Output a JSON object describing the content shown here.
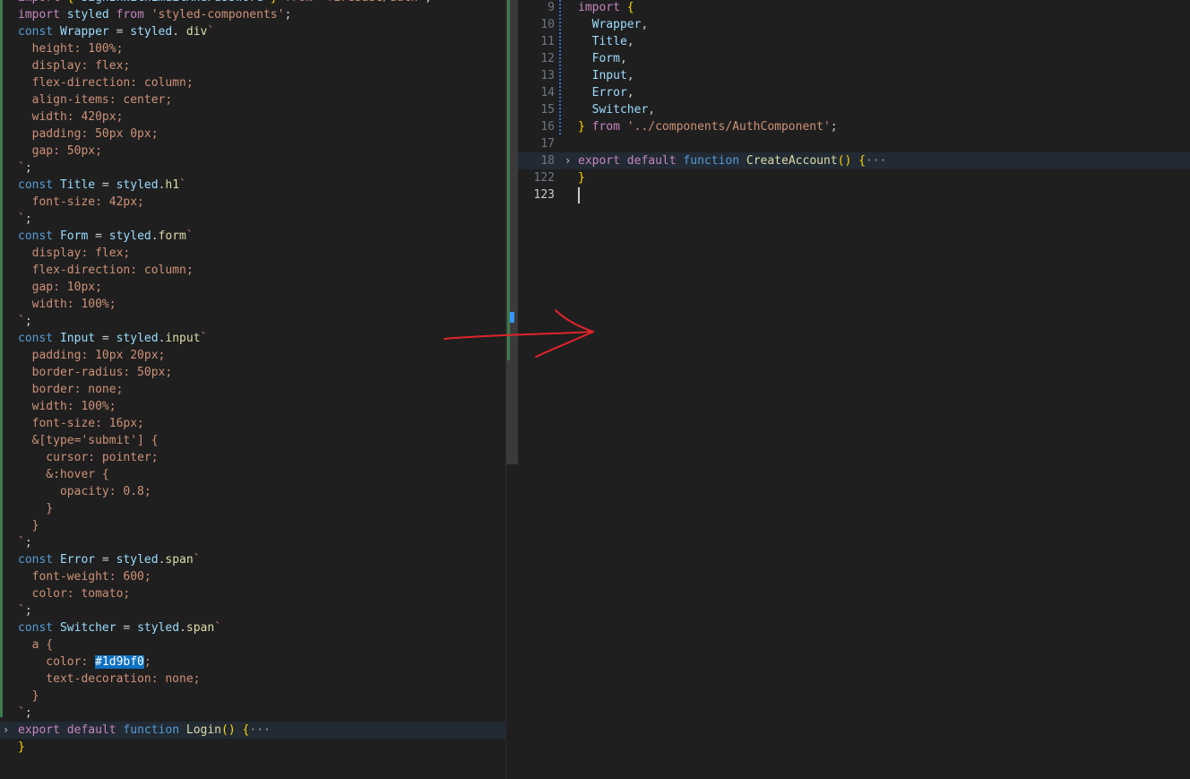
{
  "left_editor": {
    "lines": [
      {
        "tokens": [
          [
            "kp",
            "import "
          ],
          [
            "b1",
            "{ "
          ],
          [
            "v",
            "signInWithEmailAndPassword"
          ],
          [
            "b1",
            " } "
          ],
          [
            "kp",
            "from "
          ],
          [
            "s",
            "'firebase/auth'"
          ],
          [
            "",
            "; "
          ]
        ]
      },
      {
        "tokens": [
          [
            "kp",
            "import "
          ],
          [
            "v",
            "styled "
          ],
          [
            "kp",
            "from "
          ],
          [
            "s",
            "'styled-components'"
          ],
          [
            "",
            ";"
          ]
        ]
      },
      {
        "tokens": [
          [
            "k",
            "const "
          ],
          [
            "v",
            "Wrapper"
          ],
          [
            "",
            " = "
          ],
          [
            "v",
            "styled"
          ],
          [
            "",
            ". "
          ],
          [
            "f",
            "div"
          ],
          [
            "bt",
            "`"
          ]
        ]
      },
      {
        "tokens": [
          [
            "c",
            "  height: 100%;"
          ]
        ]
      },
      {
        "tokens": [
          [
            "c",
            "  display: flex;"
          ]
        ]
      },
      {
        "tokens": [
          [
            "c",
            "  flex-direction: column;"
          ]
        ]
      },
      {
        "tokens": [
          [
            "c",
            "  align-items: center;"
          ]
        ]
      },
      {
        "tokens": [
          [
            "c",
            "  width: 420px;"
          ]
        ]
      },
      {
        "tokens": [
          [
            "c",
            "  padding: 50px 0px;"
          ]
        ]
      },
      {
        "tokens": [
          [
            "c",
            "  gap: 50px;"
          ]
        ]
      },
      {
        "tokens": [
          [
            "bt",
            "`"
          ],
          [
            "",
            ";"
          ]
        ]
      },
      {
        "tokens": [
          [
            "k",
            "const "
          ],
          [
            "v",
            "Title"
          ],
          [
            "",
            " = "
          ],
          [
            "v",
            "styled"
          ],
          [
            "",
            "."
          ],
          [
            "f",
            "h1"
          ],
          [
            "bt",
            "`"
          ]
        ]
      },
      {
        "tokens": [
          [
            "c",
            "  font-size: 42px;"
          ]
        ]
      },
      {
        "tokens": [
          [
            "bt",
            "`"
          ],
          [
            "",
            ";"
          ]
        ]
      },
      {
        "tokens": [
          [
            "k",
            "const "
          ],
          [
            "v",
            "Form"
          ],
          [
            "",
            " = "
          ],
          [
            "v",
            "styled"
          ],
          [
            "",
            "."
          ],
          [
            "f",
            "form"
          ],
          [
            "bt",
            "`"
          ]
        ]
      },
      {
        "tokens": [
          [
            "c",
            "  display: flex;"
          ]
        ]
      },
      {
        "tokens": [
          [
            "c",
            "  flex-direction: column;"
          ]
        ]
      },
      {
        "tokens": [
          [
            "c",
            "  gap: 10px;"
          ]
        ]
      },
      {
        "tokens": [
          [
            "c",
            "  width: 100%;"
          ]
        ]
      },
      {
        "tokens": [
          [
            "bt",
            "`"
          ],
          [
            "",
            ";"
          ]
        ]
      },
      {
        "tokens": [
          [
            "k",
            "const "
          ],
          [
            "v",
            "Input"
          ],
          [
            "",
            " = "
          ],
          [
            "v",
            "styled"
          ],
          [
            "",
            "."
          ],
          [
            "f",
            "input"
          ],
          [
            "bt",
            "`"
          ]
        ]
      },
      {
        "tokens": [
          [
            "c",
            "  padding: 10px 20px;"
          ]
        ]
      },
      {
        "tokens": [
          [
            "c",
            "  border-radius: 50px;"
          ]
        ]
      },
      {
        "tokens": [
          [
            "c",
            "  border: none;"
          ]
        ]
      },
      {
        "tokens": [
          [
            "c",
            "  width: 100%;"
          ]
        ]
      },
      {
        "tokens": [
          [
            "c",
            "  font-size: 16px;"
          ]
        ]
      },
      {
        "tokens": [
          [
            "c",
            "  &[type='submit'] {"
          ]
        ]
      },
      {
        "tokens": [
          [
            "c",
            "    cursor: pointer;"
          ]
        ]
      },
      {
        "tokens": [
          [
            "c",
            "    &:hover {"
          ]
        ]
      },
      {
        "tokens": [
          [
            "c",
            "      opacity: 0.8;"
          ]
        ]
      },
      {
        "tokens": [
          [
            "c",
            "    }"
          ]
        ]
      },
      {
        "tokens": [
          [
            "c",
            "  }"
          ]
        ]
      },
      {
        "tokens": [
          [
            "bt",
            "`"
          ],
          [
            "",
            ";"
          ]
        ]
      },
      {
        "tokens": [
          [
            "k",
            "const "
          ],
          [
            "v",
            "Error"
          ],
          [
            "",
            " = "
          ],
          [
            "v",
            "styled"
          ],
          [
            "",
            "."
          ],
          [
            "f",
            "span"
          ],
          [
            "bt",
            "`"
          ]
        ]
      },
      {
        "tokens": [
          [
            "c",
            "  font-weight: 600;"
          ]
        ]
      },
      {
        "tokens": [
          [
            "c",
            "  color: tomato;"
          ]
        ]
      },
      {
        "tokens": [
          [
            "bt",
            "`"
          ],
          [
            "",
            ";"
          ]
        ]
      },
      {
        "tokens": [
          [
            "k",
            "const "
          ],
          [
            "v",
            "Switcher"
          ],
          [
            "",
            " = "
          ],
          [
            "v",
            "styled"
          ],
          [
            "",
            "."
          ],
          [
            "f",
            "span"
          ],
          [
            "bt",
            "`"
          ]
        ]
      },
      {
        "tokens": [
          [
            "c",
            "  a {"
          ]
        ]
      },
      {
        "tokens": [
          [
            "c",
            "    color: "
          ],
          [
            "sel2",
            "#1d9bf0"
          ],
          [
            "c",
            ";"
          ]
        ]
      },
      {
        "tokens": [
          [
            "c",
            "    text-decoration: none;"
          ]
        ]
      },
      {
        "tokens": [
          [
            "c",
            "  }"
          ]
        ]
      },
      {
        "tokens": [
          [
            "bt",
            "`"
          ],
          [
            "",
            ";"
          ]
        ]
      },
      {
        "fold": true,
        "highlight": true,
        "tokens": [
          [
            "kp",
            "export "
          ],
          [
            "kp",
            "default "
          ],
          [
            "k",
            "function "
          ],
          [
            "f",
            "Login"
          ],
          [
            "b1",
            "() {"
          ],
          [
            "dots",
            "···"
          ]
        ]
      },
      {
        "tokens": [
          [
            "b1",
            "}"
          ]
        ]
      }
    ]
  },
  "right_editor": {
    "lines": [
      {
        "num": "9",
        "tokens": [
          [
            "kp",
            "import "
          ],
          [
            "b1",
            "{"
          ]
        ]
      },
      {
        "num": "10",
        "tokens": [
          [
            "v",
            "  Wrapper"
          ],
          [
            "",
            ","
          ]
        ]
      },
      {
        "num": "11",
        "tokens": [
          [
            "v",
            "  Title"
          ],
          [
            "",
            ","
          ]
        ]
      },
      {
        "num": "12",
        "tokens": [
          [
            "v",
            "  Form"
          ],
          [
            "",
            ","
          ]
        ]
      },
      {
        "num": "13",
        "tokens": [
          [
            "v",
            "  Input"
          ],
          [
            "",
            ","
          ]
        ]
      },
      {
        "num": "14",
        "tokens": [
          [
            "v",
            "  Error"
          ],
          [
            "",
            ","
          ]
        ]
      },
      {
        "num": "15",
        "tokens": [
          [
            "v",
            "  Switcher"
          ],
          [
            "",
            ","
          ]
        ]
      },
      {
        "num": "16",
        "tokens": [
          [
            "b1",
            "} "
          ],
          [
            "kp",
            "from "
          ],
          [
            "s",
            "'../components/AuthComponent'"
          ],
          [
            "",
            ";"
          ]
        ]
      },
      {
        "num": "17",
        "tokens": []
      },
      {
        "num": "18",
        "fold": true,
        "highlight": true,
        "tokens": [
          [
            "kp",
            "export "
          ],
          [
            "kp",
            "default "
          ],
          [
            "k",
            "function "
          ],
          [
            "f",
            "CreateAccount"
          ],
          [
            "b1",
            "() {"
          ],
          [
            "dots",
            "···"
          ]
        ]
      },
      {
        "num": "122",
        "tokens": [
          [
            "b1",
            "}"
          ]
        ]
      },
      {
        "num": "123",
        "current": true,
        "tokens": []
      }
    ]
  },
  "colors": {
    "background": "#1f1f1f",
    "annotation_arrow": "#e0242a"
  }
}
